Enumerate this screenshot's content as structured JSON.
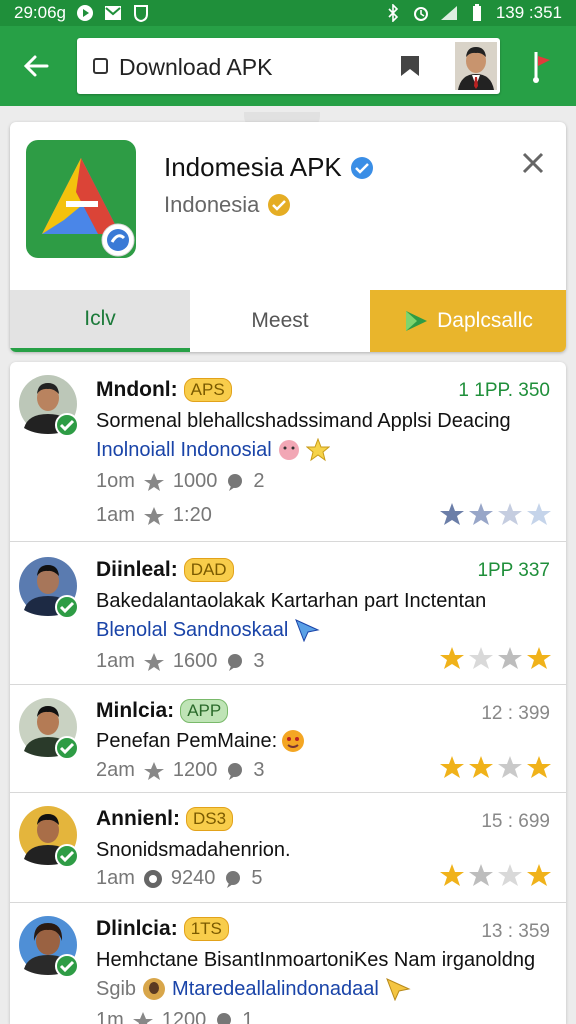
{
  "status_bar": {
    "time": "29:06g",
    "battery_time": "139 :351"
  },
  "search": {
    "query": "Download APK"
  },
  "app": {
    "title": "Indomesia APK",
    "subtitle": "Indonesia",
    "tabs": [
      "Iclv",
      "Meest",
      "Daplcsallc"
    ]
  },
  "reviews": [
    {
      "name": "Mndonl:",
      "badge": "APS",
      "amount": "1 1PP. 350",
      "amount_color": "#1f8f3a",
      "message": "Sormenal blehallcshadssimand Applsi Deacing",
      "tag": "Inolnoiall Indonosial",
      "meta1_label": "1om",
      "meta1_value": "1000",
      "meta1_count": "2",
      "meta2_label": "1am",
      "meta2_value": "1:20",
      "stars": [
        1,
        1,
        0,
        0
      ],
      "star_color": "#6b7ea8"
    },
    {
      "name": "Diinleal:",
      "badge": "DAD",
      "amount": "1PP 337",
      "amount_color": "#1f8f3a",
      "message": "Bakedalantaolakak Kartarhan part Inctentan",
      "tag": "Blenolal Sandnoskaal",
      "meta1_label": "1am",
      "meta1_value": "1600",
      "meta1_count": "3",
      "stars": [
        1,
        0,
        0,
        1
      ],
      "star_color": "#f0b21a"
    },
    {
      "name": "Minlcia:",
      "badge": "APP",
      "amount": "12 : 399",
      "amount_color": "#888888",
      "message": "Penefan PemMaine:",
      "tag": "",
      "meta1_label": "2am",
      "meta1_value": "1200",
      "meta1_count": "3",
      "stars": [
        1,
        1,
        0,
        1
      ],
      "star_color": "#f0b21a"
    },
    {
      "name": "Annienl:",
      "badge": "DS3",
      "amount": "15 : 699",
      "amount_color": "#888888",
      "message": "Snonidsmadahenrion.",
      "tag": "",
      "meta1_label": "1am",
      "meta1_value": "9240",
      "meta1_count": "5",
      "stars": [
        1,
        0,
        0,
        1
      ],
      "star_color": "#f0b21a"
    },
    {
      "name": "Dlinlcia:",
      "badge": "1TS",
      "amount": "13 : 359",
      "amount_color": "#888888",
      "message": "Hemhctane BisantInmoartoniKes Nam irganoldng",
      "tag": "Mtaredeallalindonadaal",
      "tag_prefix": "Sgib",
      "meta1_label": "1m",
      "meta1_value": "1200",
      "meta1_count": "1",
      "stars": [],
      "star_color": "#f0b21a"
    }
  ],
  "colors": {
    "primary": "#27a046",
    "accent": "#e9b52c",
    "link": "#1a44a8"
  }
}
